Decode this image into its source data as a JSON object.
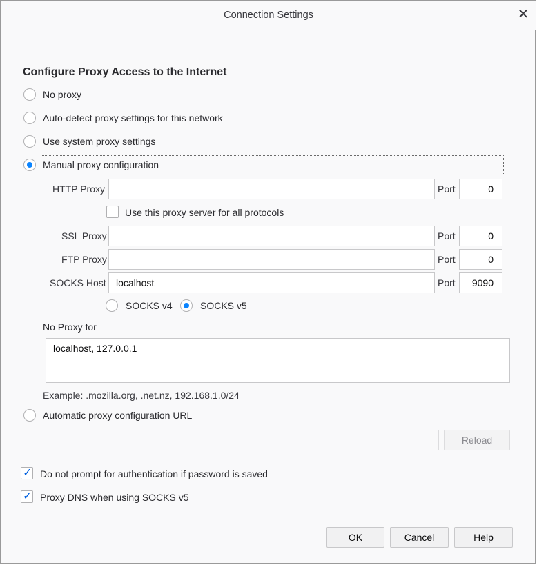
{
  "window": {
    "title": "Connection Settings"
  },
  "heading": "Configure Proxy Access to the Internet",
  "proxy_options": {
    "no_proxy": "No proxy",
    "auto_detect": "Auto-detect proxy settings for this network",
    "system": "Use system proxy settings",
    "manual": "Manual proxy configuration",
    "selected": "manual"
  },
  "manual": {
    "http_label": "HTTP Proxy",
    "http_value": "",
    "http_port": "0",
    "port_label": "Port",
    "all_protocols_label": "Use this proxy server for all protocols",
    "ssl_label": "SSL Proxy",
    "ssl_value": "",
    "ssl_port": "0",
    "ftp_label": "FTP Proxy",
    "ftp_value": "",
    "ftp_port": "0",
    "socks_label": "SOCKS Host",
    "socks_value": "localhost",
    "socks_port": "9090",
    "socks_v4": "SOCKS v4",
    "socks_v5": "SOCKS v5",
    "socks_version": "v5"
  },
  "no_proxy": {
    "label": "No Proxy for",
    "value": "localhost, 127.0.0.1",
    "example": "Example: .mozilla.org, .net.nz, 192.168.1.0/24"
  },
  "auto_url": {
    "label": "Automatic proxy configuration URL",
    "value": "",
    "reload_label": "Reload"
  },
  "options": {
    "no_prompt_auth": "Do not prompt for authentication if password is saved",
    "no_prompt_auth_checked": true,
    "proxy_dns": "Proxy DNS when using SOCKS v5",
    "proxy_dns_checked": true
  },
  "buttons": {
    "ok": "OK",
    "cancel": "Cancel",
    "help": "Help"
  },
  "colors": {
    "accent": "#0a84ff",
    "check": "#0060df"
  }
}
